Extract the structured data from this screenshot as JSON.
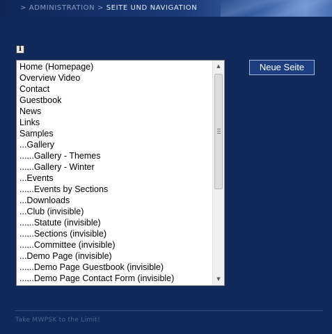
{
  "breadcrumb": {
    "sep1": ">",
    "section": "ADMINISTRATION",
    "sep2": ">",
    "current": "SEITE UND NAVIGATION"
  },
  "info_icon": {
    "glyph": "i",
    "icon": "info-icon"
  },
  "page_list": {
    "items": [
      "Home (Homepage)",
      "Overview Video",
      "Contact",
      "Guestbook",
      "News",
      "Links",
      "Samples",
      "...Gallery",
      "......Gallery - Themes",
      "......Gallery - Winter",
      "...Events",
      "......Events by Sections",
      "...Downloads",
      "...Club (invisible)",
      "......Statute (invisible)",
      "......Sections (invisible)",
      "......Committee (invisible)",
      "...Demo Page (invisible)",
      "......Demo Page Guestbook (invisible)",
      "......Demo Page Contact Form (invisible)"
    ],
    "scrollbar": {
      "up_glyph": "▲",
      "down_glyph": "▼"
    }
  },
  "new_page_button": {
    "label": "Neue Seite"
  },
  "footer": {
    "text": "Take MWPSK to the Limit!"
  }
}
